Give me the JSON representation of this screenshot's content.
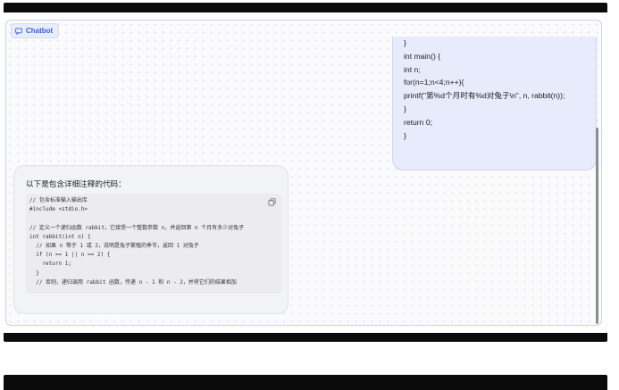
{
  "chatbot": {
    "label": "Chatbot"
  },
  "user_message": {
    "lines": [
      "}",
      "int main() {",
      "int n;",
      "for(n=1;n<4;n++){",
      "printf(\"第%d个月时有%d对兔子\\n\", n, rabbit(n));",
      "}",
      "return 0;",
      "}"
    ]
  },
  "bot_message": {
    "intro": "以下是包含详细注释的代码：",
    "code_lines": [
      "// 包含标准输入输出库",
      "#include <stdio.h>",
      "",
      "// 定义一个递归函数 rabbit，它接受一个整数参数 n，并返回第 n 个月有多少对兔子",
      "int rabbit(int n) {",
      "  // 如果 n 等于 1 或 2，说明是兔子繁殖的季节，返回 1 对兔子",
      "  if (n == 1 || n == 2) {",
      "    return 1;",
      "  }",
      "  // 否则，递归调用 rabbit 函数，传递 n - 1 和 n - 2，并将它们的结果相加"
    ]
  },
  "icons": {
    "chatbot": "chat-icon",
    "copy": "copy-icon"
  },
  "colors": {
    "accent": "#3b5bdb",
    "user_bubble": "#e7ebfc",
    "bot_bubble": "#f2f3f6"
  }
}
